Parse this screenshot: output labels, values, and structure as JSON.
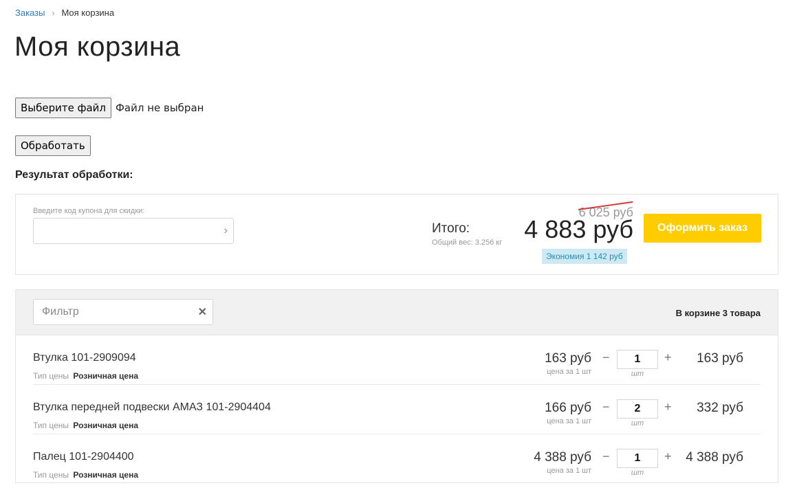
{
  "breadcrumb": {
    "parent": "Заказы",
    "separator": "›",
    "current": "Моя корзина"
  },
  "page_title": "Моя корзина",
  "file_upload": {
    "button_label": "Выберите файл",
    "status": "Файл не выбран"
  },
  "process_button": "Обработать",
  "result_title": "Результат обработки:",
  "coupon": {
    "label": "Введите код купона для скидки:",
    "value": ""
  },
  "summary": {
    "total_label": "Итого:",
    "weight": "Общий вес: 3.256 кг",
    "old_price": "6 025 руб",
    "total_price": "4 883 руб",
    "savings": "Экономия 1 142 руб",
    "checkout_label": "Оформить заказ"
  },
  "cart": {
    "filter_placeholder": "Фильтр",
    "count_label": "В корзине 3 товара",
    "price_type_label": "Тип цены",
    "unit_note": "цена за 1 шт",
    "qty_unit": "шт",
    "items": [
      {
        "name": "Втулка 101-2909094",
        "price_type": "Розничная цена",
        "unit_price": "163 руб",
        "qty": "1",
        "total": "163 руб"
      },
      {
        "name": "Втулка передней подвески АМАЗ 101-2904404",
        "price_type": "Розничная цена",
        "unit_price": "166 руб",
        "qty": "2",
        "total": "332 руб"
      },
      {
        "name": "Палец 101-2904400",
        "price_type": "Розничная цена",
        "unit_price": "4 388 руб",
        "qty": "1",
        "total": "4 388 руб"
      }
    ]
  },
  "colors": {
    "link": "#2f7cc1",
    "accent": "#ffcc00",
    "strike": "#d23a3a",
    "savings_bg": "#cfe9f4",
    "savings_text": "#1d8fb5"
  },
  "icons": {
    "coupon_submit": "chevron-right-icon",
    "filter_clear": "close-icon"
  }
}
